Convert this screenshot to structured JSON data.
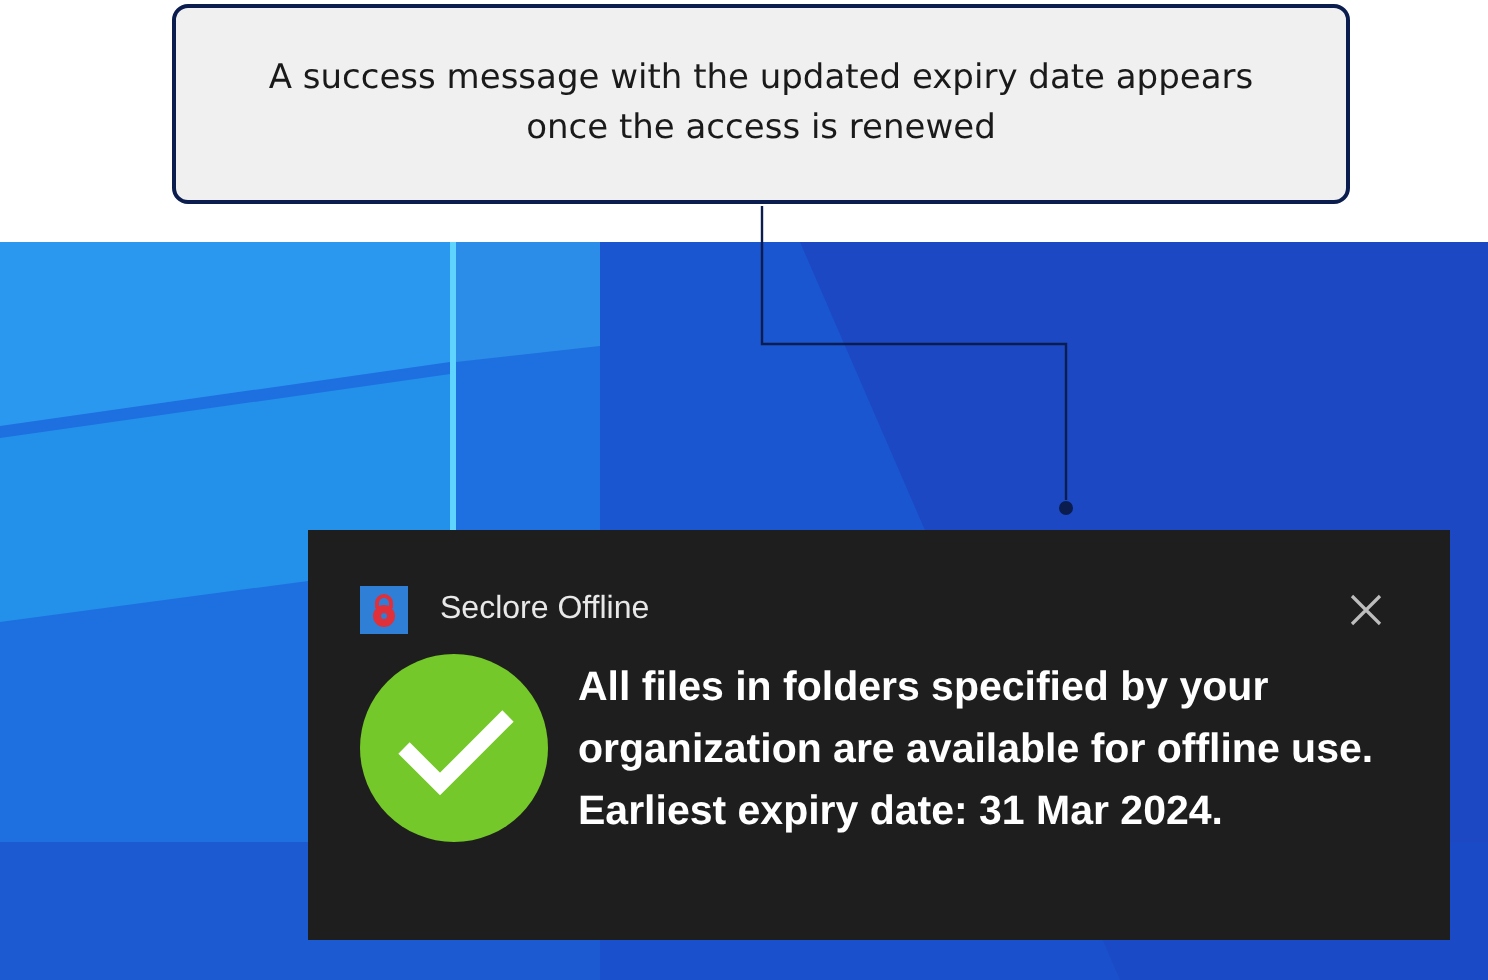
{
  "callout": {
    "text": "A success message with the updated expiry date appears once the access is renewed"
  },
  "toast": {
    "app_name": "Seclore Offline",
    "message": "All files in folders specified by your organization are available for offline use. Earliest expiry date: 31 Mar 2024."
  }
}
